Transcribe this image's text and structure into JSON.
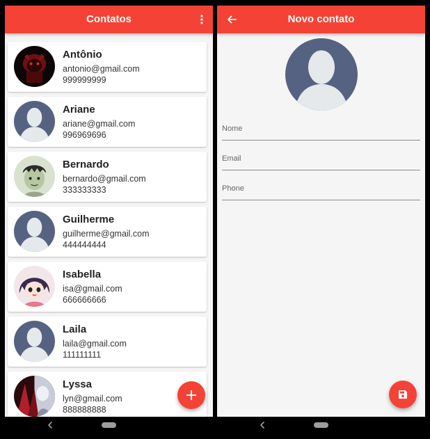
{
  "contacts_screen": {
    "title": "Contatos",
    "menu_icon": "more-vert-icon",
    "fab_icon": "add-icon",
    "contacts": [
      {
        "name": "Antônio",
        "email": "antonio@gmail.com",
        "phone": "999999999",
        "avatar": "dark-red-creature-photo"
      },
      {
        "name": "Ariane",
        "email": "ariane@gmail.com",
        "phone": "996969696",
        "avatar": "default-person-placeholder"
      },
      {
        "name": "Bernardo",
        "email": "bernardo@gmail.com",
        "phone": "333333333",
        "avatar": "cartoon-boy-drawing"
      },
      {
        "name": "Guilherme",
        "email": "guilherme@gmail.com",
        "phone": "444444444",
        "avatar": "default-person-placeholder"
      },
      {
        "name": "Isabella",
        "email": "isa@gmail.com",
        "phone": "666666666",
        "avatar": "anime-girl-drawing"
      },
      {
        "name": "Laila",
        "email": "laila@gmail.com",
        "phone": "111111111",
        "avatar": "default-person-placeholder"
      },
      {
        "name": "Lyssa",
        "email": "lyn@gmail.com",
        "phone": "888888888",
        "avatar": "red-silver-character-art"
      }
    ]
  },
  "new_contact_screen": {
    "title": "Novo contato",
    "back_icon": "arrow-back-icon",
    "avatar": "default-person-placeholder",
    "fields": {
      "nome": {
        "placeholder": "Nome",
        "value": ""
      },
      "email": {
        "placeholder": "Email",
        "value": ""
      },
      "phone": {
        "placeholder": "Phone",
        "value": ""
      }
    },
    "fab_icon": "save-icon"
  },
  "system_nav": {
    "back_icon": "nav-back-icon",
    "home_icon": "nav-home-pill"
  },
  "colors": {
    "accent": "#f44336",
    "background": "#f5f5f5",
    "card": "#ffffff",
    "placeholder_avatar_bg": "#566281",
    "placeholder_avatar_figure": "#e6e9ec"
  }
}
